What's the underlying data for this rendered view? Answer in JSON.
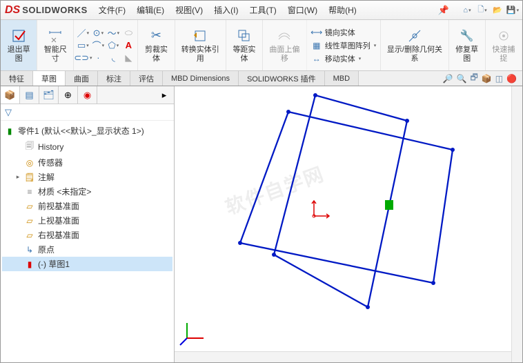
{
  "logo_text": "SOLIDWORKS",
  "menus": {
    "file": "文件(F)",
    "edit": "编辑(E)",
    "view": "视图(V)",
    "insert": "插入(I)",
    "tools": "工具(T)",
    "window": "窗口(W)",
    "help": "帮助(H)"
  },
  "ribbon": {
    "exit_sketch": "退出草图",
    "smart_dim": "智能尺寸",
    "trim": "剪裁实体",
    "convert": "转换实体引用",
    "offset": "等距实体",
    "offset_surface": "曲面上偏移",
    "mirror": "镜向实体",
    "linear_pattern": "线性草图阵列",
    "move": "移动实体",
    "show_rel": "显示/删除几何关系",
    "repair": "修复草图",
    "quick_snap": "快速捕捉"
  },
  "tabs": [
    "特征",
    "草图",
    "曲面",
    "标注",
    "评估",
    "MBD Dimensions",
    "SOLIDWORKS 插件",
    "MBD"
  ],
  "active_tab_index": 1,
  "tree": {
    "root": "零件1 (默认<<默认>_显示状态 1>)",
    "history": "History",
    "sensor": "传感器",
    "annot": "注解",
    "material": "材质 <未指定>",
    "plane_front": "前视基准面",
    "plane_top": "上视基准面",
    "plane_right": "右视基准面",
    "origin": "原点",
    "sketch1": "(-) 草图1"
  },
  "watermark": "软件自学网"
}
